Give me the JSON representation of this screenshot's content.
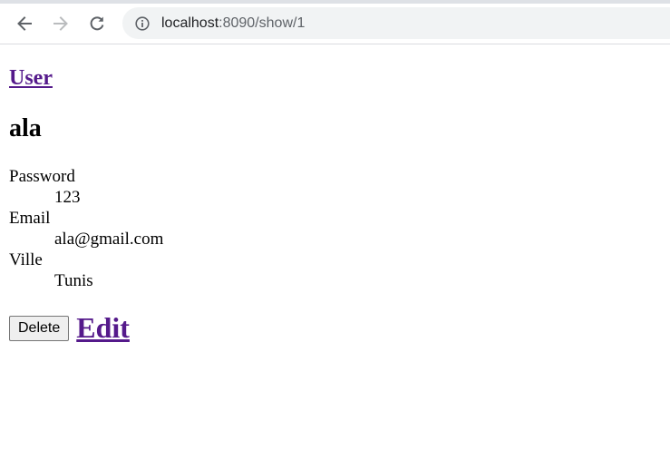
{
  "browser": {
    "url_host": "localhost",
    "url_path": ":8090/show/1",
    "icons": {
      "back": "arrow-left-icon",
      "forward": "arrow-right-icon",
      "reload": "reload-icon",
      "info": "info-icon"
    }
  },
  "page": {
    "breadcrumb_label": "User",
    "name": "ala",
    "fields": [
      {
        "label": "Password",
        "value": "123"
      },
      {
        "label": "Email",
        "value": "ala@gmail.com"
      },
      {
        "label": "Ville",
        "value": "Tunis"
      }
    ],
    "delete_label": "Delete",
    "edit_label": "Edit"
  },
  "colors": {
    "link_visited": "#551a8b",
    "omnibox_bg": "#f1f3f4"
  }
}
